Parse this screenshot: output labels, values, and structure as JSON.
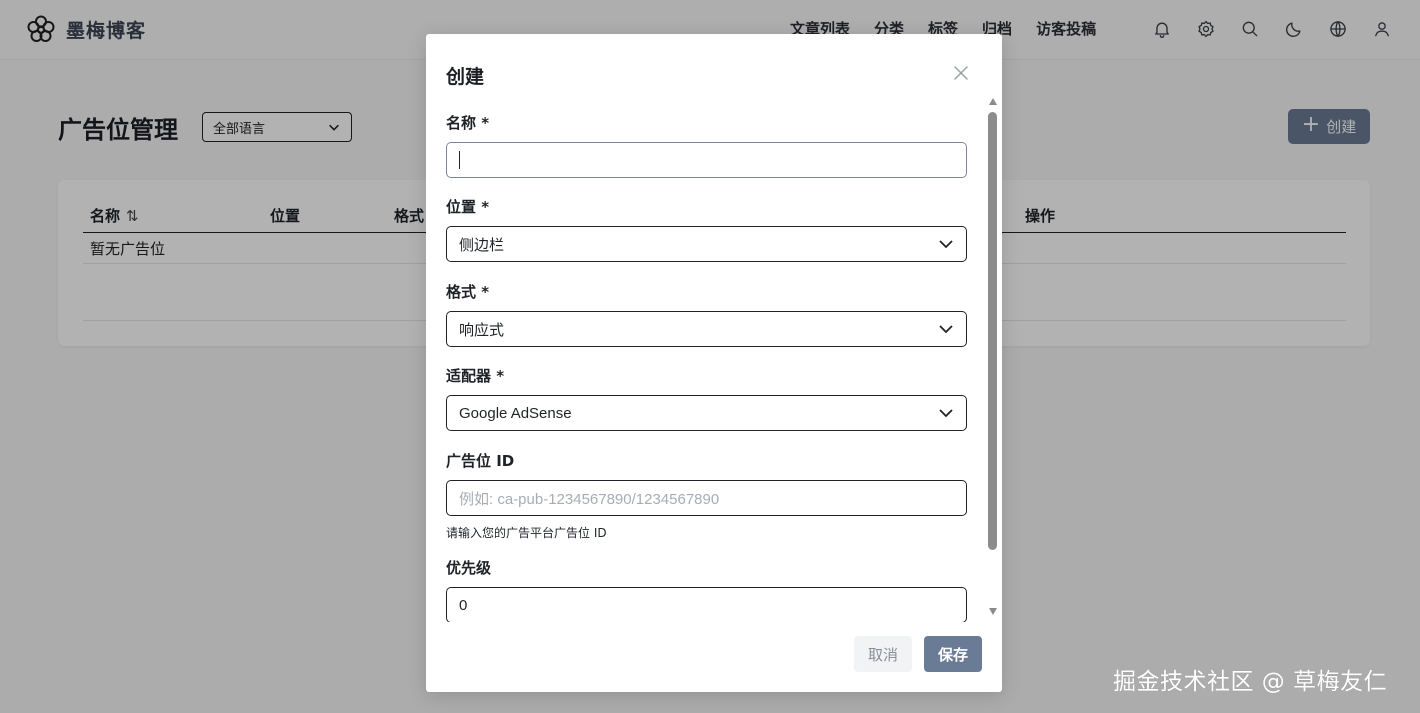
{
  "brand": {
    "name": "墨梅博客",
    "logo_icon": "plum-blossom-logo"
  },
  "nav": {
    "items": [
      "文章列表",
      "分类",
      "标签",
      "归档",
      "访客投稿"
    ]
  },
  "header_icons": [
    "bell-icon",
    "gear-icon",
    "search-icon",
    "moon-icon",
    "globe-icon",
    "user-icon"
  ],
  "page": {
    "title": "广告位管理",
    "language_filter": "全部语言",
    "create_button": "创建"
  },
  "table": {
    "columns": [
      "名称",
      "位置",
      "格式",
      "操作"
    ],
    "empty_text": "暂无广告位"
  },
  "modal": {
    "title": "创建",
    "fields": {
      "name": {
        "label": "名称 *",
        "value": ""
      },
      "position": {
        "label": "位置 *",
        "value": "侧边栏"
      },
      "format": {
        "label": "格式 *",
        "value": "响应式"
      },
      "adapter": {
        "label": "适配器 *",
        "value": "Google AdSense"
      },
      "slot_id": {
        "label": "广告位 ID",
        "placeholder": "例如: ca-pub-1234567890/1234567890",
        "hint": "请输入您的广告平台广告位 ID"
      },
      "priority": {
        "label": "优先级",
        "value": "0"
      }
    },
    "cancel_button": "取消",
    "save_button": "保存"
  },
  "watermark": "掘金技术社区 @ 草梅友仁",
  "colors": {
    "accent": "#6a7b95",
    "overlay": "rgba(0,0,0,0.30)"
  }
}
